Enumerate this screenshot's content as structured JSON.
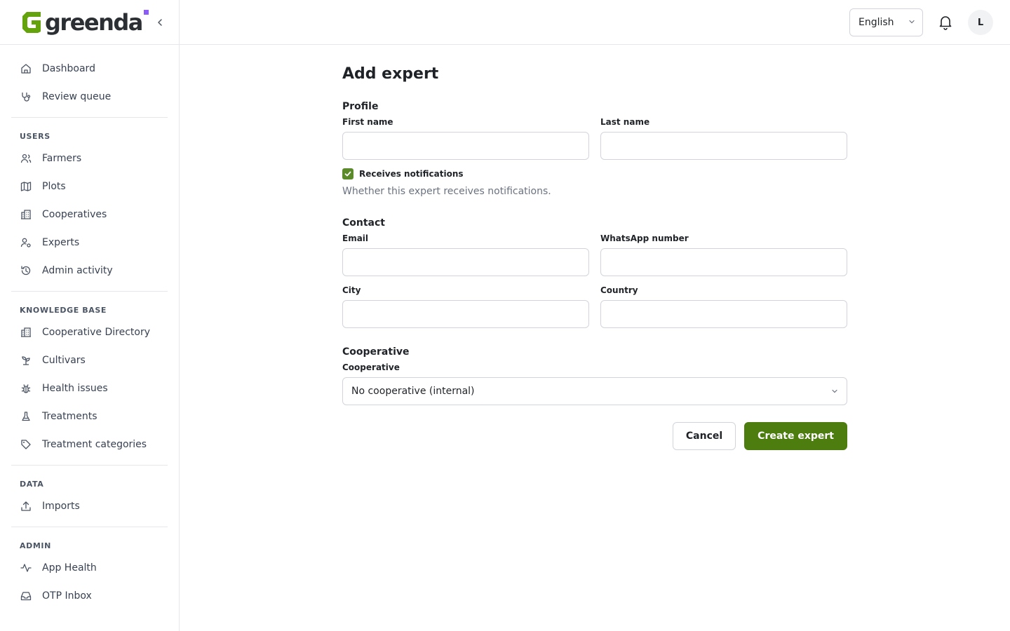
{
  "brand": {
    "name": "greenda",
    "accent": "#8b5cf6",
    "logo_color": "#65a30d"
  },
  "sidebar": {
    "groups": [
      {
        "heading": "",
        "items": [
          {
            "label": "Dashboard",
            "icon": "home-icon"
          },
          {
            "label": "Review queue",
            "icon": "stethoscope-icon"
          }
        ]
      },
      {
        "heading": "USERS",
        "items": [
          {
            "label": "Farmers",
            "icon": "users-icon"
          },
          {
            "label": "Plots",
            "icon": "map-icon"
          },
          {
            "label": "Cooperatives",
            "icon": "building-icon"
          },
          {
            "label": "Experts",
            "icon": "user-cog-icon"
          },
          {
            "label": "Admin activity",
            "icon": "history-icon"
          }
        ]
      },
      {
        "heading": "KNOWLEDGE BASE",
        "items": [
          {
            "label": "Cooperative Directory",
            "icon": "building-icon"
          },
          {
            "label": "Cultivars",
            "icon": "sprout-icon"
          },
          {
            "label": "Health issues",
            "icon": "bug-icon"
          },
          {
            "label": "Treatments",
            "icon": "flask-icon"
          },
          {
            "label": "Treatment categories",
            "icon": "tag-icon"
          }
        ]
      },
      {
        "heading": "DATA",
        "items": [
          {
            "label": "Imports",
            "icon": "upload-icon"
          }
        ]
      },
      {
        "heading": "ADMIN",
        "items": [
          {
            "label": "App Health",
            "icon": "activity-icon"
          },
          {
            "label": "OTP Inbox",
            "icon": "inbox-icon"
          }
        ]
      }
    ]
  },
  "topbar": {
    "language": "English",
    "avatar_initial": "L"
  },
  "page": {
    "title": "Add expert",
    "profile": {
      "section": "Profile",
      "first_name_label": "First name",
      "first_name_value": "",
      "last_name_label": "Last name",
      "last_name_value": "",
      "notifications_label": "Receives notifications",
      "notifications_checked": true,
      "notifications_help": "Whether this expert receives notifications."
    },
    "contact": {
      "section": "Contact",
      "email_label": "Email",
      "email_value": "",
      "whatsapp_label": "WhatsApp number",
      "whatsapp_value": "",
      "city_label": "City",
      "city_value": "",
      "country_label": "Country",
      "country_value": ""
    },
    "cooperative": {
      "section": "Cooperative",
      "label": "Cooperative",
      "value": "No cooperative (internal)"
    },
    "actions": {
      "cancel": "Cancel",
      "submit": "Create expert"
    }
  },
  "colors": {
    "primary": "#4d7c0f",
    "checkbox": "#5b8a2b"
  }
}
